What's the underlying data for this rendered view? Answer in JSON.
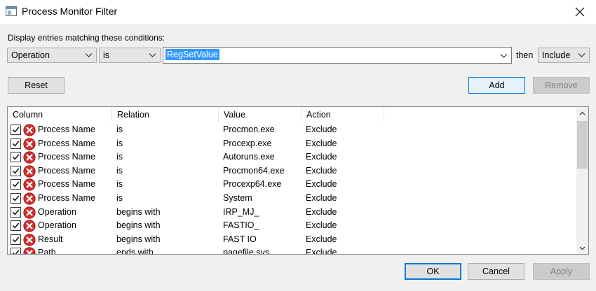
{
  "window": {
    "title": "Process Monitor Filter",
    "icon": "app-window-icon",
    "close_icon": "close-icon"
  },
  "conditions_label": "Display entries matching these conditions:",
  "filter": {
    "column": "Operation",
    "relation": "is",
    "value": "RegSetValue",
    "then_label": "then",
    "action": "Include"
  },
  "buttons": {
    "reset": "Reset",
    "add": "Add",
    "remove": "Remove",
    "ok": "OK",
    "cancel": "Cancel",
    "apply": "Apply"
  },
  "list": {
    "headers": [
      "Column",
      "Relation",
      "Value",
      "Action"
    ],
    "rows": [
      {
        "column": "Process Name",
        "relation": "is",
        "value": "Procmon.exe",
        "action": "Exclude",
        "checked": true
      },
      {
        "column": "Process Name",
        "relation": "is",
        "value": "Procexp.exe",
        "action": "Exclude",
        "checked": true
      },
      {
        "column": "Process Name",
        "relation": "is",
        "value": "Autoruns.exe",
        "action": "Exclude",
        "checked": true
      },
      {
        "column": "Process Name",
        "relation": "is",
        "value": "Procmon64.exe",
        "action": "Exclude",
        "checked": true
      },
      {
        "column": "Process Name",
        "relation": "is",
        "value": "Procexp64.exe",
        "action": "Exclude",
        "checked": true
      },
      {
        "column": "Process Name",
        "relation": "is",
        "value": "System",
        "action": "Exclude",
        "checked": true
      },
      {
        "column": "Operation",
        "relation": "begins with",
        "value": "IRP_MJ_",
        "action": "Exclude",
        "checked": true
      },
      {
        "column": "Operation",
        "relation": "begins with",
        "value": "FASTIO_",
        "action": "Exclude",
        "checked": true
      },
      {
        "column": "Result",
        "relation": "begins with",
        "value": "FAST IO",
        "action": "Exclude",
        "checked": true
      },
      {
        "column": "Path",
        "relation": "ends with",
        "value": "pagefile.sys",
        "action": "Exclude",
        "checked": true
      }
    ]
  },
  "colors": {
    "accent": "#0078d7",
    "selection": "#3399ff",
    "exclude_icon": "#d32f2f"
  }
}
